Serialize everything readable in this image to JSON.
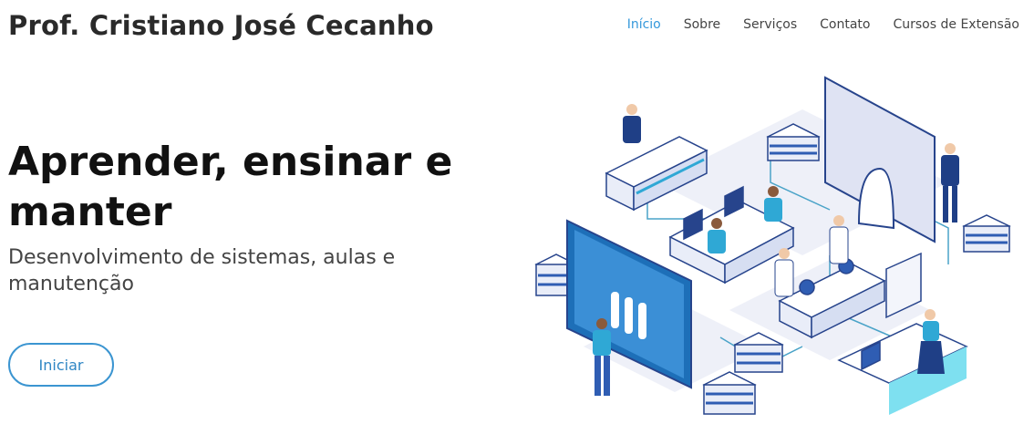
{
  "header": {
    "site_title": "Prof. Cristiano José Cecanho",
    "nav": [
      {
        "label": "Início",
        "active": true
      },
      {
        "label": "Sobre",
        "active": false
      },
      {
        "label": "Serviços",
        "active": false
      },
      {
        "label": "Contato",
        "active": false
      },
      {
        "label": "Cursos de Extensão",
        "active": false
      }
    ]
  },
  "hero": {
    "title": "Aprender, ensinar e manter",
    "subtitle": "Desenvolvimento de sistemas, aulas e manutenção",
    "cta_label": "Iniciar"
  },
  "colors": {
    "accent": "#3498db",
    "text_dark": "#111111",
    "text_muted": "#444444"
  }
}
